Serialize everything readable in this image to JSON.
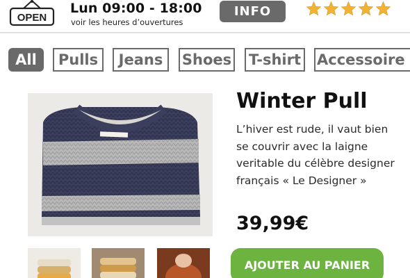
{
  "header": {
    "open_sign": "OPEN",
    "hours": "Lun 09:00 - 18:00",
    "hours_link": "voir les heures d’ouvertures",
    "info_button": "INFO",
    "rating": 5,
    "star_color": "#f2b233"
  },
  "categories": {
    "active": "All",
    "items": [
      {
        "label": "All"
      },
      {
        "label": "Pulls"
      },
      {
        "label": "Jeans"
      },
      {
        "label": "Shoes"
      },
      {
        "label": "T-shirt"
      },
      {
        "label": "Accessoire"
      }
    ]
  },
  "product": {
    "image_icon": "sweater-image",
    "title": "Winter Pull",
    "description": "L’hiver est rude, il vaut bien se couvrir avec la laigne veritable du célèbre designer français « Le Designer »",
    "price": "39,99€",
    "add_to_cart": "AJOUTER AU PANIER",
    "thumbnails": [
      {
        "icon": "folded-sweaters-image"
      },
      {
        "icon": "sweater-stack-image"
      },
      {
        "icon": "model-sweater-image"
      }
    ]
  },
  "colors": {
    "tab_gray": "#6a6a6a",
    "cart_green": "#6db33f",
    "sweater_navy": "#3b3e5c",
    "sweater_gray": "#b8b8b8"
  }
}
